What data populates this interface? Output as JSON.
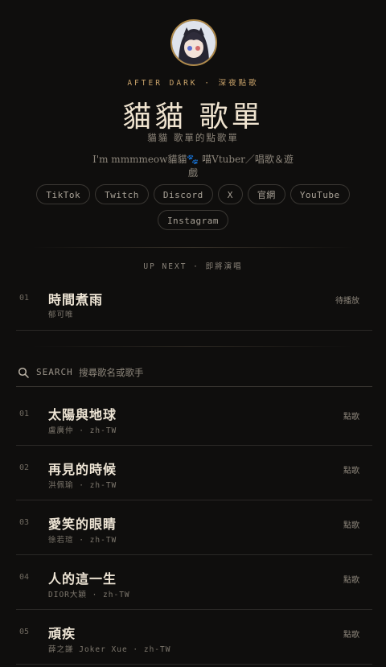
{
  "header": {
    "eyebrow": "AFTER DARK · 深夜點歌",
    "title": "貓貓 歌單",
    "subtitle": "貓貓 歌單的點歌單",
    "bio": "I'm mmmmeow貓貓🐾 喵Vtuber／唱歌＆遊戲"
  },
  "links": [
    "TikTok",
    "Twitch",
    "Discord",
    "X",
    "官網",
    "YouTube",
    "Instagram"
  ],
  "up_next": {
    "label": "UP NEXT · 即將演唱",
    "item": {
      "num": "01",
      "title": "時間煮雨",
      "artist": "郁可唯",
      "status": "待播放"
    }
  },
  "search": {
    "label": "SEARCH",
    "placeholder": "搜尋歌名或歌手",
    "value": ""
  },
  "songs": [
    {
      "num": "01",
      "title": "太陽與地球",
      "meta": "盧廣仲 · zh-TW",
      "action": "點歌"
    },
    {
      "num": "02",
      "title": "再見的時候",
      "meta": "洪佩瑜 · zh-TW",
      "action": "點歌"
    },
    {
      "num": "03",
      "title": "愛笑的眼睛",
      "meta": "徐若瑄 · zh-TW",
      "action": "點歌"
    },
    {
      "num": "04",
      "title": "人的這一生",
      "meta": "DIOR大穎 · zh-TW",
      "action": "點歌"
    },
    {
      "num": "05",
      "title": "頑疾",
      "meta": "薛之謙 Joker Xue · zh-TW",
      "action": "點歌"
    }
  ],
  "colors": {
    "background": "#0f0e0d",
    "accent_gold": "#c9a36a",
    "title_cream": "#efe3cf"
  }
}
